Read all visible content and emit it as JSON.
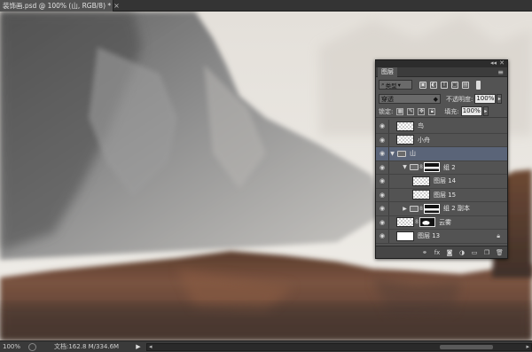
{
  "document": {
    "tab_title": "装饰画.psd @ 100% (山, RGB/8) *",
    "close_glyph": "×"
  },
  "status_bar": {
    "zoom": "100%",
    "doc_size": "文档:162.8 M/334.6M",
    "arrow": "▶"
  },
  "layers_panel": {
    "tab_label": "图层",
    "filter_kind": "类型",
    "blend_mode": "穿透",
    "opacity_label": "不透明度:",
    "opacity_value": "100%",
    "lock_label": "锁定:",
    "fill_label": "填充:",
    "fill_value": "100%",
    "layers": [
      {
        "name": "鸟",
        "type": "layer"
      },
      {
        "name": "小舟",
        "type": "layer"
      },
      {
        "name": "山",
        "type": "group",
        "selected": true
      },
      {
        "name": "组 2",
        "type": "group"
      },
      {
        "name": "图层 14",
        "type": "layer"
      },
      {
        "name": "图层 15",
        "type": "layer"
      },
      {
        "name": "组 2 副本",
        "type": "group"
      },
      {
        "name": "云雾",
        "type": "layer"
      },
      {
        "name": "图层 13",
        "type": "layer",
        "locked": true
      }
    ],
    "footer_icons": [
      "link-icon",
      "fx-icon",
      "mask-icon",
      "adjustment-icon",
      "folder-icon",
      "new-layer-icon",
      "trash-icon"
    ]
  },
  "colors": {
    "panel_bg": "#535353",
    "selected_row": "#5a6478",
    "mountain_brown": "#6b4a36",
    "sky": "#ece9e4"
  }
}
